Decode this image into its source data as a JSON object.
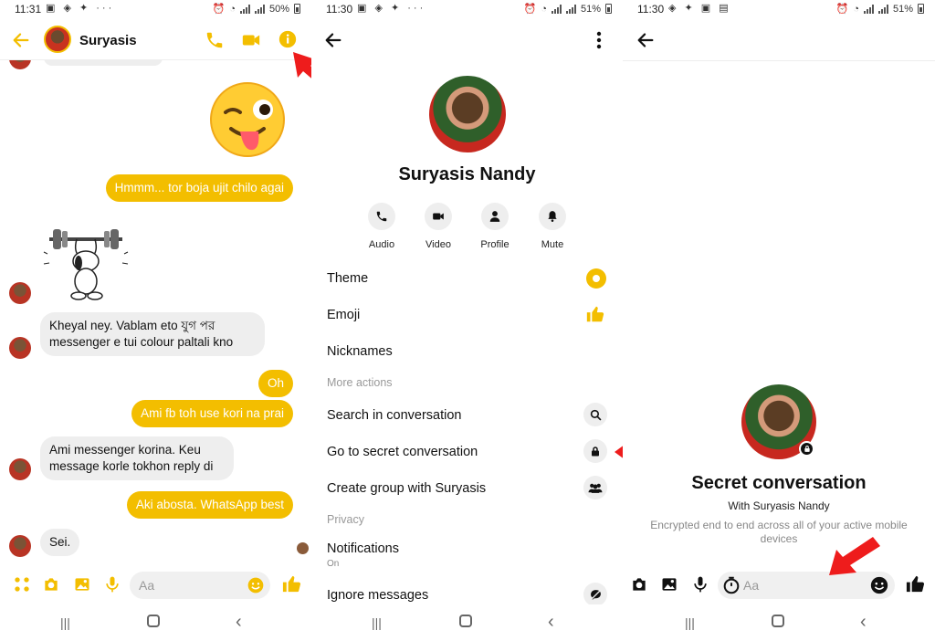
{
  "screens": [
    {
      "status": {
        "time": "11:31",
        "battery": "50%"
      },
      "header": {
        "name": "Suryasis"
      },
      "messages": [
        {
          "side": "out",
          "text": "Hmmm... tor boja ujit chilo agai"
        },
        {
          "side": "in",
          "text_line1": "Kheyal ney. Vablam eto যুগ পর",
          "text_line2": "messenger e tui colour paltali kno"
        },
        {
          "side": "out",
          "text": "Oh"
        },
        {
          "side": "out",
          "text": "Ami fb toh use kori na prai"
        },
        {
          "side": "in",
          "text_line1": "Ami messenger korina. Keu",
          "text_line2": "message korle tokhon reply di"
        },
        {
          "side": "out",
          "text": "Aki abosta. WhatsApp best"
        },
        {
          "side": "in",
          "text": "Sei."
        }
      ],
      "composer": {
        "placeholder": "Aa"
      },
      "accent": "#F3BE00"
    },
    {
      "status": {
        "time": "11:30",
        "battery": "51%"
      },
      "profile_name": "Suryasis Nandy",
      "actions": [
        "Audio",
        "Video",
        "Profile",
        "Mute"
      ],
      "menu": {
        "theme": "Theme",
        "emoji": "Emoji",
        "nicknames": "Nicknames",
        "more_actions": "More actions",
        "search": "Search in conversation",
        "secret": "Go to secret conversation",
        "group": "Create group with Suryasis",
        "privacy": "Privacy",
        "notifications": "Notifications",
        "notifications_state": "On",
        "ignore": "Ignore messages"
      }
    },
    {
      "status": {
        "time": "11:30",
        "battery": "51%"
      },
      "title": "Secret conversation",
      "with": "With Suryasis Nandy",
      "note": "Encrypted end to end across all of your active mobile devices",
      "composer": {
        "placeholder": "Aa"
      }
    }
  ]
}
